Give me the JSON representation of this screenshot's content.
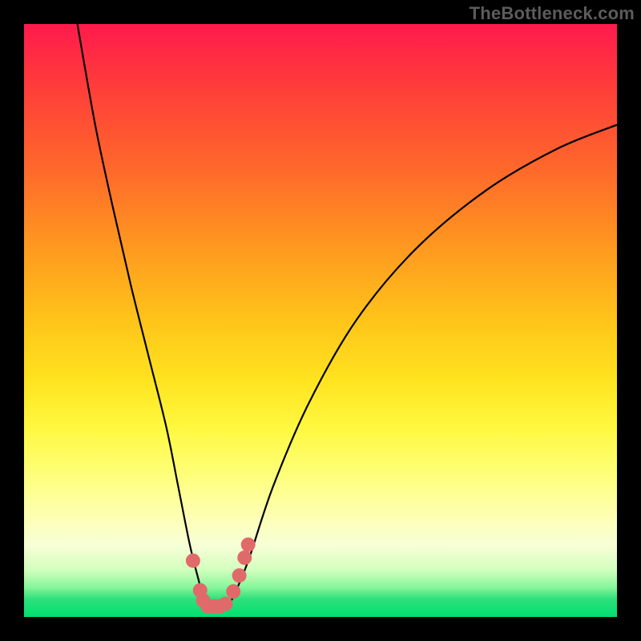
{
  "watermark": "TheBottleneck.com",
  "chart_data": {
    "type": "line",
    "title": "",
    "xlabel": "",
    "ylabel": "",
    "xlim": [
      0,
      100
    ],
    "ylim": [
      0,
      100
    ],
    "series": [
      {
        "name": "bottleneck-curve",
        "x": [
          9,
          12,
          15,
          18,
          21,
          24,
          26,
          28,
          29.5,
          30.5,
          31.5,
          33,
          34.5,
          36,
          38,
          42,
          48,
          56,
          66,
          78,
          90,
          100
        ],
        "y": [
          100,
          83,
          69,
          56,
          44,
          32,
          22,
          12,
          6,
          2.3,
          1.6,
          1.6,
          2.1,
          5,
          10,
          22,
          36,
          50,
          62,
          72,
          79,
          83
        ]
      }
    ],
    "markers": [
      {
        "x": 28.5,
        "y": 9.5
      },
      {
        "x": 29.7,
        "y": 4.5
      },
      {
        "x": 30.2,
        "y": 2.8
      },
      {
        "x": 31.0,
        "y": 1.8
      },
      {
        "x": 32.0,
        "y": 1.8
      },
      {
        "x": 33.0,
        "y": 1.8
      },
      {
        "x": 34.0,
        "y": 2.2
      },
      {
        "x": 35.3,
        "y": 4.3
      },
      {
        "x": 36.3,
        "y": 7.0
      },
      {
        "x": 37.2,
        "y": 10.0
      },
      {
        "x": 37.8,
        "y": 12.2
      }
    ],
    "marker_color": "#e06a6a",
    "curve_color": "#000000",
    "gradient_stops": [
      {
        "pos": 0,
        "color": "#ff1a4c"
      },
      {
        "pos": 50,
        "color": "#ffc41a"
      },
      {
        "pos": 76,
        "color": "#feff7a"
      },
      {
        "pos": 92,
        "color": "#d3ffbe"
      },
      {
        "pos": 100,
        "color": "#00e070"
      }
    ]
  }
}
